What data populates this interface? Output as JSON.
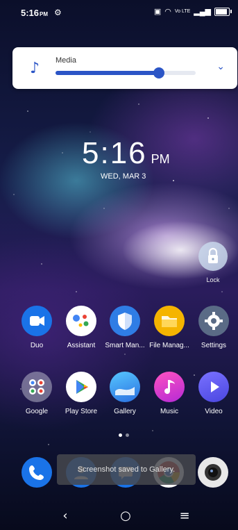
{
  "status_bar": {
    "time": "5:16",
    "ampm": "PM",
    "network": "Vo LTE",
    "battery_level": 0.9
  },
  "volume_panel": {
    "label": "Media",
    "level": 0.74
  },
  "lock_clock": {
    "time": "5:16",
    "ampm": "PM",
    "date": "WED, MAR 3"
  },
  "lock_widget": {
    "label": "Lock"
  },
  "apps_row1": [
    {
      "label": "Duo",
      "icon": "duo-icon"
    },
    {
      "label": "Assistant",
      "icon": "assistant-icon"
    },
    {
      "label": "Smart Man...",
      "icon": "shield-icon"
    },
    {
      "label": "File Manag...",
      "icon": "folder-icon"
    },
    {
      "label": "Settings",
      "icon": "gear-icon"
    }
  ],
  "apps_row2": [
    {
      "label": "Google",
      "icon": "google-folder-icon"
    },
    {
      "label": "Play Store",
      "icon": "play-store-icon"
    },
    {
      "label": "Gallery",
      "icon": "gallery-icon"
    },
    {
      "label": "Music",
      "icon": "music-icon"
    },
    {
      "label": "Video",
      "icon": "video-icon"
    }
  ],
  "dock": [
    "phone-icon",
    "contacts-icon",
    "messages-icon",
    "chrome-icon",
    "camera-icon"
  ],
  "toast": {
    "text": "Screenshot saved to Gallery."
  },
  "colors": {
    "accent": "#2b55c6"
  }
}
